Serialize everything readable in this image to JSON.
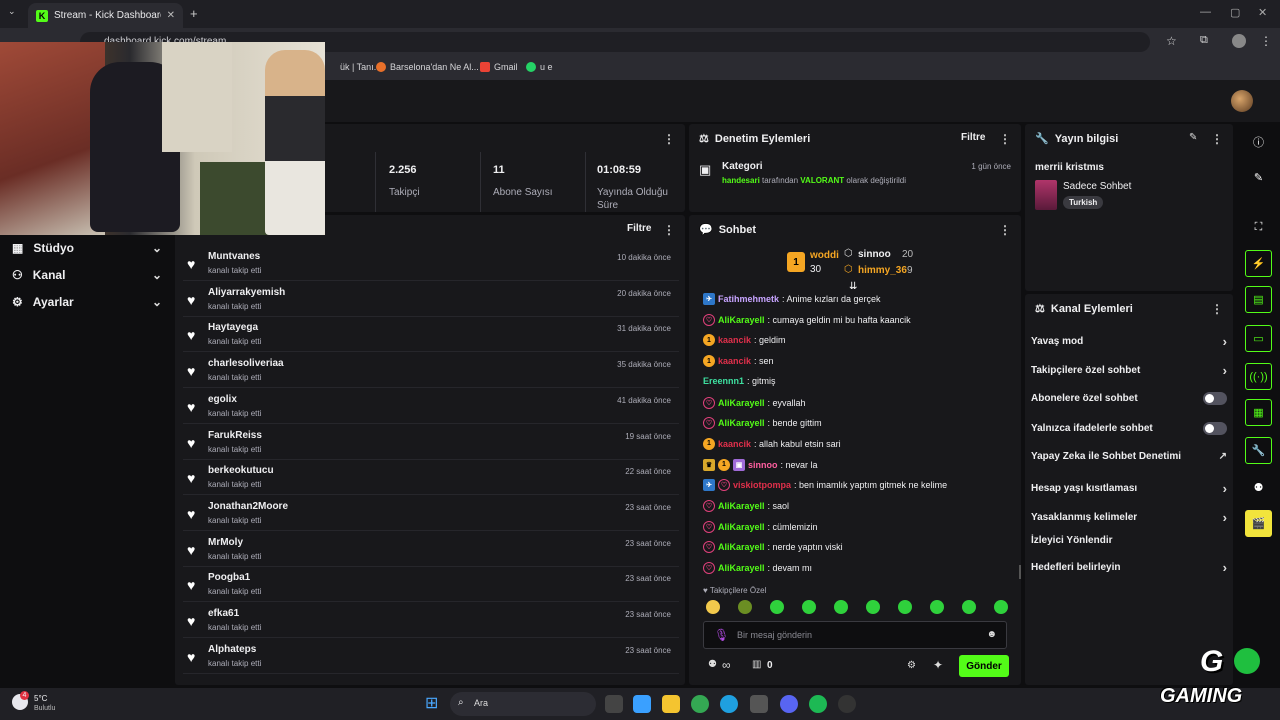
{
  "browser": {
    "tab_title": "Stream - Kick Dashboard",
    "url": "dashboard.kick.com/stream",
    "bookmarks": [
      "ük | Tanı...",
      "Barselona'dan Ne Al...",
      "Gmail",
      "u e"
    ]
  },
  "nav": {
    "items": [
      {
        "label": "Stüdyo"
      },
      {
        "label": "Kanal"
      },
      {
        "label": "Ayarlar"
      }
    ]
  },
  "stats": [
    {
      "value": "2.256",
      "label": "Takipçi"
    },
    {
      "value": "11",
      "label": "Abone Sayısı"
    },
    {
      "value": "01:08:59",
      "label": "Yayında Olduğu Süre"
    }
  ],
  "followers": {
    "filter_label": "Filtre",
    "action": "kanalı takip etti",
    "rows": [
      {
        "name": "Muntvanes",
        "time": "10 dakika önce"
      },
      {
        "name": "Aliyarrakyemish",
        "time": "20 dakika önce"
      },
      {
        "name": "Haytayega",
        "time": "31 dakika önce"
      },
      {
        "name": "charlesoliveriaa",
        "time": "35 dakika önce"
      },
      {
        "name": "egolix",
        "time": "41 dakika önce"
      },
      {
        "name": "FarukReiss",
        "time": "19 saat önce"
      },
      {
        "name": "berkeokutucu",
        "time": "22 saat önce"
      },
      {
        "name": "Jonathan2Moore",
        "time": "23 saat önce"
      },
      {
        "name": "MrMoly",
        "time": "23 saat önce"
      },
      {
        "name": "Poogba1",
        "time": "23 saat önce"
      },
      {
        "name": "efka61",
        "time": "23 saat önce"
      },
      {
        "name": "Alphateps",
        "time": "23 saat önce"
      }
    ]
  },
  "moderation": {
    "title": "Denetim Eylemleri",
    "filter_label": "Filtre",
    "event_title": "Kategori",
    "event_time": "1 gün önce",
    "event_user": "handesari",
    "event_text_1": "tarafından",
    "event_category": "VALORANT",
    "event_text_2": "olarak değiştirildi"
  },
  "chat": {
    "title": "Sohbet",
    "leaders": [
      {
        "name": "woddi",
        "count": "30"
      },
      {
        "name": "sinnoo",
        "count": "20"
      },
      {
        "name": "himmy_36",
        "count": "9"
      }
    ],
    "rank": "1",
    "messages": [
      {
        "user": "Fatihmehmetk",
        "text": ": Anime kızları da gerçek",
        "color": "#c7a4ff"
      },
      {
        "user": "AliKarayell",
        "text": ": cumaya geldin mi bu hafta kaancik",
        "color": "#53fc18"
      },
      {
        "user": "kaancik",
        "text": ": geldim",
        "color": "#e0304b"
      },
      {
        "user": "kaancik",
        "text": ": sen",
        "color": "#e0304b"
      },
      {
        "user": "Ereennn1",
        "text": ": gitmiş",
        "color": "#3ee0a0"
      },
      {
        "user": "AliKarayell",
        "text": ": eyvallah",
        "color": "#53fc18"
      },
      {
        "user": "AliKarayell",
        "text": ": bende gittim",
        "color": "#53fc18"
      },
      {
        "user": "kaancik",
        "text": ": allah kabul etsin sari",
        "color": "#e0304b"
      },
      {
        "user": "sinnoo",
        "text": ": nevar la",
        "color": "#ff5fa0"
      },
      {
        "user": "viskiotpompa",
        "text": ": ben imamlık yaptım gitmek ne kelime",
        "color": "#e0304b"
      },
      {
        "user": "AliKarayell",
        "text": ": saol",
        "color": "#53fc18"
      },
      {
        "user": "AliKarayell",
        "text": ": cümlemizin",
        "color": "#53fc18"
      },
      {
        "user": "AliKarayell",
        "text": ": nerde yaptın viski",
        "color": "#53fc18"
      },
      {
        "user": "AliKarayell",
        "text": ": devam mı",
        "color": "#53fc18"
      }
    ],
    "followers_only": "Takipçilere Özel",
    "input_placeholder": "Bir mesaj gönderin",
    "infinity": "∞",
    "shop_count": "0",
    "send_label": "Gönder"
  },
  "stream_info": {
    "title": "Yayın bilgisi",
    "stream_title": "merrii kristmıs",
    "category": "Sadece Sohbet",
    "tag": "Turkish"
  },
  "channel_actions": {
    "title": "Kanal Eylemleri",
    "items": [
      {
        "label": "Yavaş mod",
        "control": "chevron"
      },
      {
        "label": "Takipçilere özel sohbet",
        "control": "chevron"
      },
      {
        "label": "Abonelere özel sohbet",
        "control": "toggle"
      },
      {
        "label": "Yalnızca ifadelerle sohbet",
        "control": "toggle"
      },
      {
        "label": "Yapay Zeka ile Sohbet Denetimi",
        "control": "external"
      },
      {
        "label": "Hesap yaşı kısıtlaması",
        "control": "chevron"
      },
      {
        "label": "Yasaklanmış kelimeler",
        "control": "chevron"
      },
      {
        "label": "İzleyici Yönlendir",
        "control": "none"
      },
      {
        "label": "Hedefleri belirleyin",
        "control": "chevron"
      }
    ]
  },
  "taskbar": {
    "temp": "5°C",
    "weather": "Bulutlu",
    "search": "Ara",
    "weather_badge": "4"
  },
  "watermark": "GAMING"
}
